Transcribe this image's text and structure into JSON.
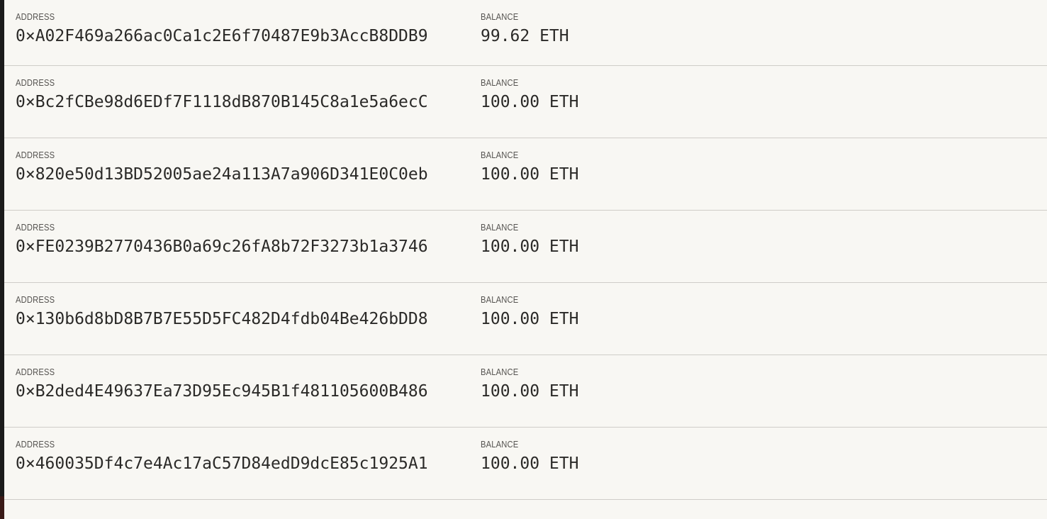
{
  "accounts_list": {
    "address_label": "ADDRESS",
    "balance_label": "BALANCE",
    "accounts": [
      {
        "address": "0×A02F469a266ac0Ca1c2E6f70487E9b3AccB8DDB9",
        "balance": "99.62 ETH"
      },
      {
        "address": "0×Bc2fCBe98d6EDf7F1118dB870B145C8a1e5a6ecC",
        "balance": "100.00 ETH"
      },
      {
        "address": "0×820e50d13BD52005ae24a113A7a906D341E0C0eb",
        "balance": "100.00 ETH"
      },
      {
        "address": "0×FE0239B2770436B0a69c26fA8b72F3273b1a3746",
        "balance": "100.00 ETH"
      },
      {
        "address": "0×130b6d8bD8B7B7E55D5FC482D4fdb04Be426bDD8",
        "balance": "100.00 ETH"
      },
      {
        "address": "0×B2ded4E49637Ea73D95Ec945B1f481105600B486",
        "balance": "100.00 ETH"
      },
      {
        "address": "0×460035Df4c7e4Ac17aC57D84edD9dcE85c1925A1",
        "balance": "100.00 ETH"
      }
    ]
  }
}
